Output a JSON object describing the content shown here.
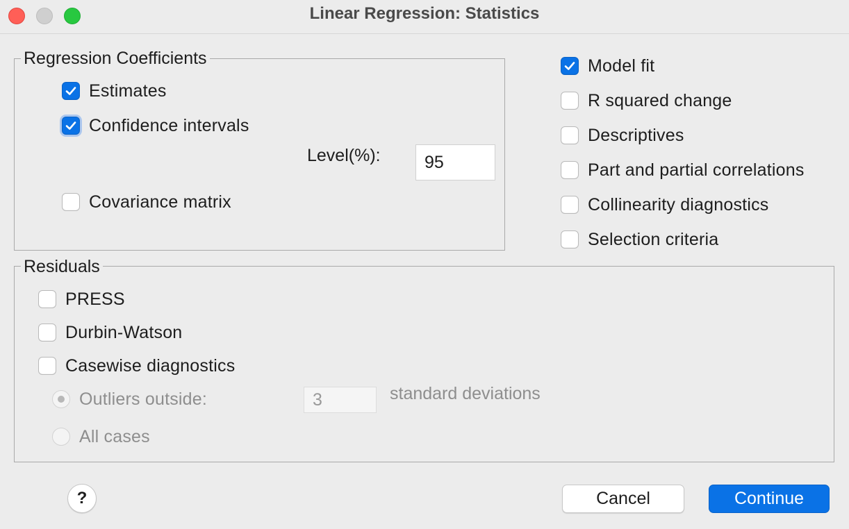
{
  "window": {
    "title": "Linear Regression: Statistics"
  },
  "regression_coefficients": {
    "legend": "Regression Coefficients",
    "estimates": {
      "label": "Estimates",
      "checked": true
    },
    "confidence_intervals": {
      "label": "Confidence intervals",
      "checked": true
    },
    "level_label": "Level(%):",
    "level_value": "95",
    "covariance_matrix": {
      "label": "Covariance matrix",
      "checked": false
    }
  },
  "options": {
    "model_fit": {
      "label": "Model fit",
      "checked": true
    },
    "r_squared_change": {
      "label": "R squared change",
      "checked": false
    },
    "descriptives": {
      "label": "Descriptives",
      "checked": false
    },
    "part_partial": {
      "label": "Part and partial correlations",
      "checked": false
    },
    "collinearity": {
      "label": "Collinearity diagnostics",
      "checked": false
    },
    "selection_criteria": {
      "label": "Selection criteria",
      "checked": false
    }
  },
  "residuals": {
    "legend": "Residuals",
    "press": {
      "label": "PRESS",
      "checked": false
    },
    "durbin_watson": {
      "label": "Durbin-Watson",
      "checked": false
    },
    "casewise": {
      "label": "Casewise diagnostics",
      "checked": false
    },
    "outliers_outside": {
      "label": "Outliers outside:",
      "selected": true,
      "enabled": false
    },
    "outliers_value": "3",
    "standard_deviations_label": "standard deviations",
    "all_cases": {
      "label": "All cases",
      "selected": false,
      "enabled": false
    }
  },
  "buttons": {
    "help_label": "?",
    "cancel_label": "Cancel",
    "continue_label": "Continue"
  },
  "colors": {
    "accent": "#0a72e6",
    "close": "#ff5f57",
    "minimize": "#cfcfcf",
    "maximize": "#28c840"
  }
}
